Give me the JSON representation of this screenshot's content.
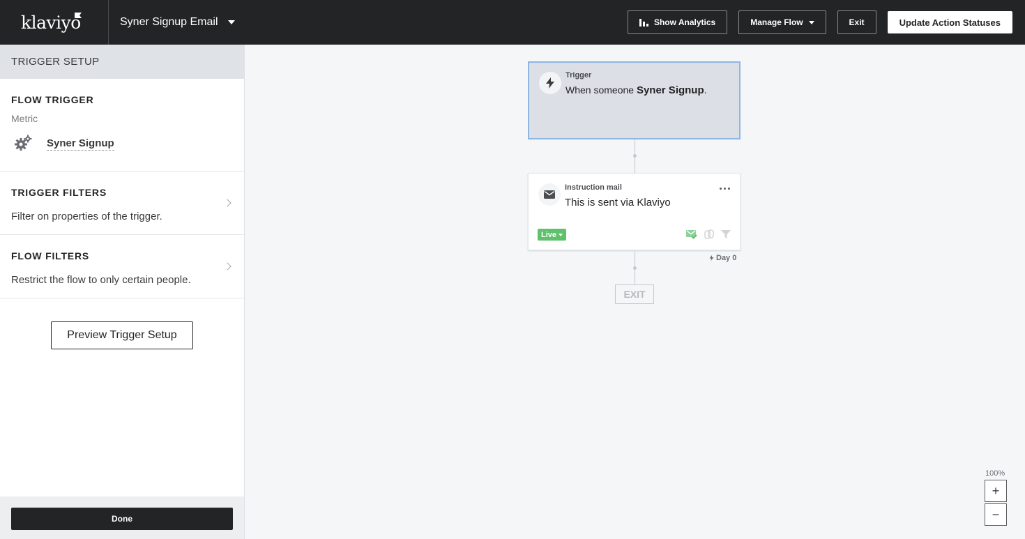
{
  "app": {
    "logo": "klaviyo",
    "flow_name": "Syner Signup Email"
  },
  "toolbar": {
    "show_analytics": "Show Analytics",
    "manage_flow": "Manage Flow",
    "exit": "Exit",
    "update_statuses": "Update Action Statuses"
  },
  "sidebar": {
    "header": "TRIGGER SETUP",
    "flow_trigger": {
      "title": "FLOW TRIGGER",
      "type": "Metric",
      "metric": "Syner Signup",
      "icon": "gears-icon"
    },
    "trigger_filters": {
      "title": "TRIGGER FILTERS",
      "desc": "Filter on properties of the trigger."
    },
    "flow_filters": {
      "title": "FLOW FILTERS",
      "desc": "Restrict the flow to only certain people."
    },
    "preview_button": "Preview Trigger Setup",
    "done_button": "Done"
  },
  "canvas": {
    "trigger": {
      "label": "Trigger",
      "text_prefix": "When someone ",
      "metric": "Syner Signup",
      "text_suffix": ".",
      "icon": "lightning-icon"
    },
    "email": {
      "label": "Instruction mail",
      "text": "This is sent via Klaviyo",
      "status": "Live",
      "icon": "envelope-icon"
    },
    "delay": "Day 0",
    "exit": "EXIT",
    "zoom": "100%",
    "zoom_in": "+",
    "zoom_out": "−"
  },
  "colors": {
    "topbar": "#232426",
    "live": "#5fc16c",
    "trigger_bg": "#dcdfe6",
    "trigger_border": "#8fb6e0"
  }
}
